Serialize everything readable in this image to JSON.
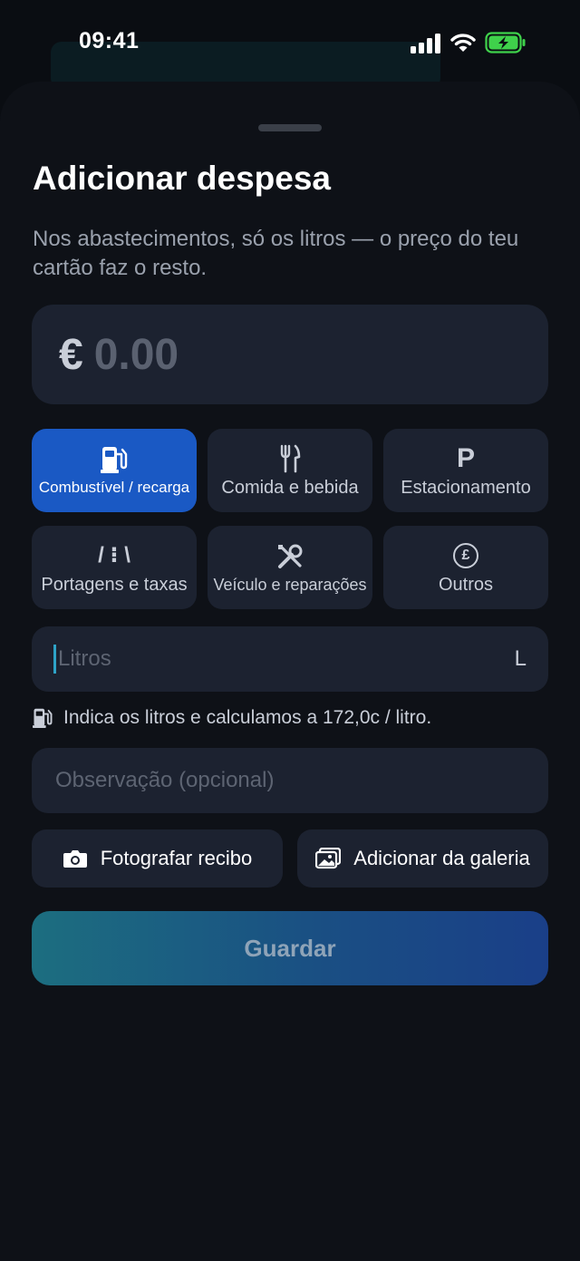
{
  "status_bar": {
    "time": "09:41"
  },
  "sheet": {
    "title": "Adicionar despesa",
    "subtitle": "Nos abastecimentos, só os litros — o preço do teu cartão faz o resto."
  },
  "amount": {
    "currency": "€",
    "value": "0.00"
  },
  "categories": [
    {
      "label": "Combustível / recarga",
      "icon": "fuel-pump-icon",
      "selected": true
    },
    {
      "label": "Comida e bebida",
      "icon": "fork-knife-icon",
      "selected": false
    },
    {
      "label": "Estacionamento",
      "icon": "parking-icon",
      "glyph": "P",
      "selected": false
    },
    {
      "label": "Portagens e taxas",
      "icon": "road-icon",
      "glyph": "/ ⁝ \\",
      "selected": false
    },
    {
      "label": "Veículo e reparações",
      "icon": "tools-icon",
      "selected": false
    },
    {
      "label": "Outros",
      "icon": "coin-icon",
      "glyph": "£",
      "selected": false
    }
  ],
  "liters": {
    "placeholder": "Litros",
    "value": "",
    "unit": "L"
  },
  "hint": {
    "text": "Indica os litros e calculamos a 172,0c / litro."
  },
  "note": {
    "placeholder": "Observação (opcional)",
    "value": ""
  },
  "actions": {
    "photo_label": "Fotografar recibo",
    "gallery_label": "Adicionar da galeria"
  },
  "save_label": "Guardar",
  "colors": {
    "accent": "#1a59c4",
    "surface": "#1c2230",
    "sheet": "#0e1117"
  }
}
